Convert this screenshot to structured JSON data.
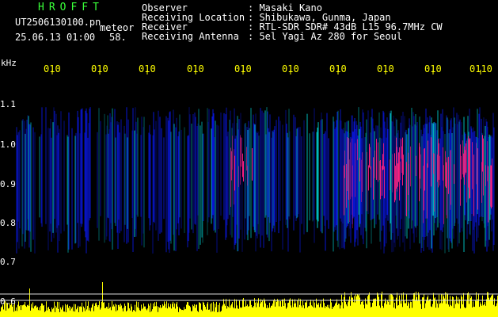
{
  "header": {
    "app_title": "HROFFT",
    "filename": "UT2506130100.pn",
    "meteor_label": "meteor",
    "datetime": "25.06.13 01:00",
    "count": "58.",
    "info": [
      {
        "key": "Observer",
        "value": ": Masaki Kano"
      },
      {
        "key": "Receiving Location",
        "value": ": Shibukawa, Gunma, Japan"
      },
      {
        "key": "Receiver",
        "value": ": RTL-SDR SDR# 43dB L15 96.7MHz CW"
      },
      {
        "key": "Receiving Antenna",
        "value": ": 5el Yagi Az 280 for Seoul"
      }
    ]
  },
  "axis": {
    "unit": "kHz",
    "freq_ticks": [
      "1.1",
      "1.0",
      "0.9",
      "0.8",
      "0.7",
      "0.6"
    ],
    "freq_values": [
      1.1,
      1.0,
      0.9,
      0.8,
      0.7,
      0.6
    ],
    "time_labels": [
      "010",
      "010",
      "010",
      "010",
      "010",
      "010",
      "010",
      "010",
      "010",
      "0110"
    ]
  },
  "colors": {
    "background": "#000000",
    "title": "#39ff39",
    "time_labels": "#ffff00",
    "signal_low": "#0a1aff",
    "signal_mid": "#00e0e0",
    "signal_high": "#ff2080",
    "activity": "#ffff00"
  }
}
